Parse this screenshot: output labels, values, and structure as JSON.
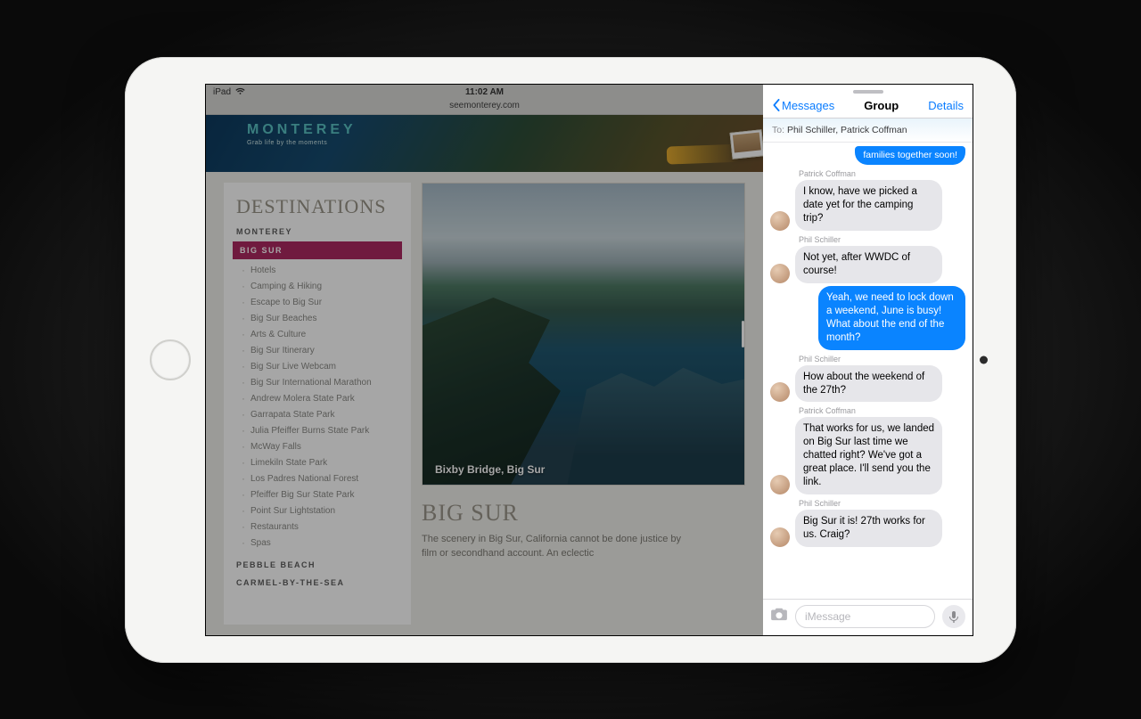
{
  "status": {
    "carrier": "iPad",
    "time": "11:02 AM"
  },
  "safari": {
    "url": "seemonterey.com",
    "brand": "MONTEREY",
    "tagline": "Grab life by the moments",
    "sidebar_title": "DESTINATIONS",
    "regions": {
      "r1": "MONTEREY",
      "active": "BIG SUR",
      "r3": "PEBBLE BEACH",
      "r4": "CARMEL-BY-THE-SEA"
    },
    "bigsur_items": {
      "i0": "Hotels",
      "i1": "Camping & Hiking",
      "i2": "Escape to Big Sur",
      "i3": "Big Sur Beaches",
      "i4": "Arts & Culture",
      "i5": "Big Sur Itinerary",
      "i6": "Big Sur Live Webcam",
      "i7": "Big Sur International Marathon",
      "i8": "Andrew Molera State Park",
      "i9": "Garrapata State Park",
      "i10": "Julia Pfeiffer Burns State Park",
      "i11": "McWay Falls",
      "i12": "Limekiln State Park",
      "i13": "Los Padres National Forest",
      "i14": "Pfeiffer Big Sur State Park",
      "i15": "Point Sur Lightstation",
      "i16": "Restaurants",
      "i17": "Spas"
    },
    "hero_caption": "Bixby Bridge, Big Sur",
    "article_title": "BIG SUR",
    "article_body": "The scenery in Big Sur, California cannot be done justice by film or secondhand account. An eclectic"
  },
  "messages": {
    "back": "Messages",
    "title": "Group",
    "details": "Details",
    "to_label": "To:",
    "to_names": "Phil Schiller, Patrick Coffman",
    "compose_placeholder": "iMessage",
    "senders": {
      "phil": "Phil Schiller",
      "patrick": "Patrick Coffman"
    },
    "m0": "families together soon!",
    "m1": "I know, have we picked a date yet for the camping trip?",
    "m2": "Not yet, after WWDC of course!",
    "m3": "Yeah, we need to lock down a weekend, June is busy! What about the end of the month?",
    "m4": "How about the weekend of the 27th?",
    "m5": "That works for us, we landed on Big Sur last time we chatted right? We've got a great place. I'll send you the link.",
    "m6": "Big Sur it is! 27th works for us. Craig?"
  }
}
